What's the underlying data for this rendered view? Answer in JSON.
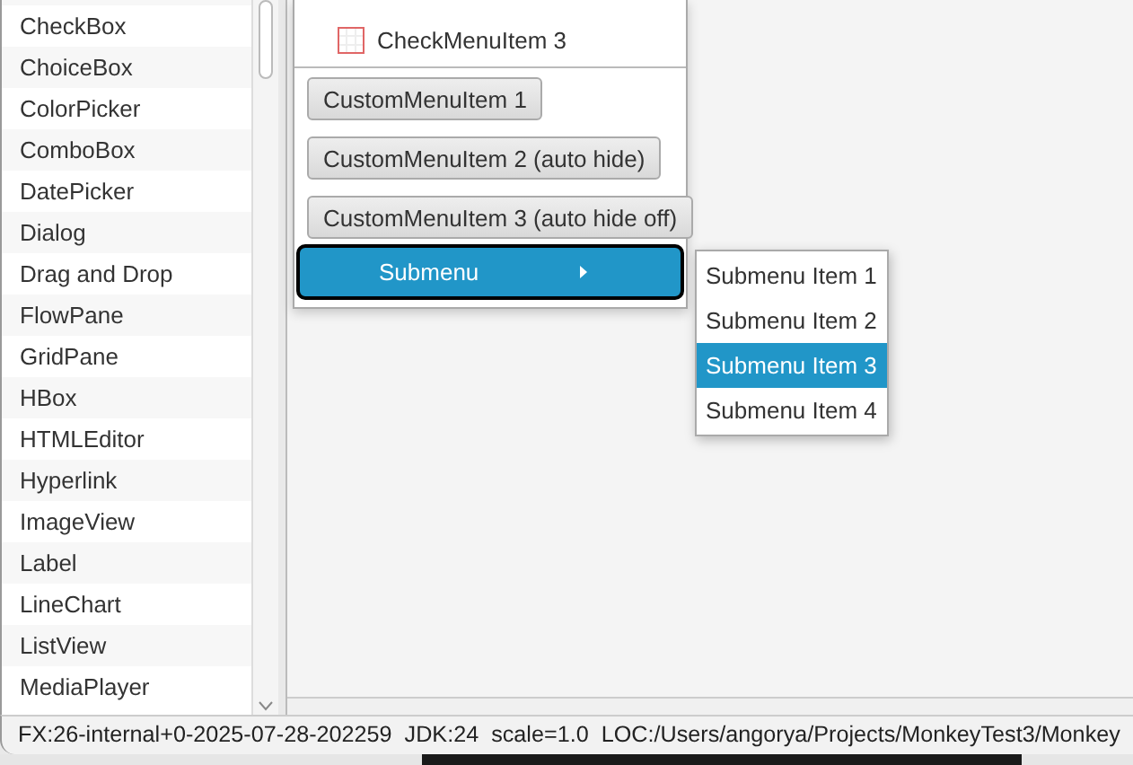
{
  "sidebar": {
    "items": [
      {
        "label": "CheckBox"
      },
      {
        "label": "ChoiceBox"
      },
      {
        "label": "ColorPicker"
      },
      {
        "label": "ComboBox"
      },
      {
        "label": "DatePicker"
      },
      {
        "label": "Dialog"
      },
      {
        "label": "Drag and Drop"
      },
      {
        "label": "FlowPane"
      },
      {
        "label": "GridPane"
      },
      {
        "label": "HBox"
      },
      {
        "label": "HTMLEditor"
      },
      {
        "label": "Hyperlink"
      },
      {
        "label": "ImageView"
      },
      {
        "label": "Label"
      },
      {
        "label": "LineChart"
      },
      {
        "label": "ListView"
      },
      {
        "label": "MediaPlayer"
      }
    ]
  },
  "menu": {
    "items": [
      {
        "kind": "check",
        "label": "CheckMenuItem 3",
        "checked": false
      },
      {
        "kind": "separator"
      },
      {
        "kind": "custom",
        "label": "CustomMenuItem 1"
      },
      {
        "kind": "custom",
        "label": "CustomMenuItem 2 (auto hide)"
      },
      {
        "kind": "custom",
        "label": "CustomMenuItem 3 (auto hide off)"
      },
      {
        "kind": "submenu",
        "label": "Submenu",
        "selected": true
      }
    ]
  },
  "submenu": {
    "items": [
      {
        "label": "Submenu Item 1",
        "selected": false
      },
      {
        "label": "Submenu Item 2",
        "selected": false
      },
      {
        "label": "Submenu Item 3",
        "selected": true
      },
      {
        "label": "Submenu Item 4",
        "selected": false
      }
    ]
  },
  "status_bar": {
    "text": "FX:26-internal+0-2025-07-28-202259  JDK:24  scale=1.0  LOC:/Users/angorya/Projects/MonkeyTest3/Monkey"
  }
}
